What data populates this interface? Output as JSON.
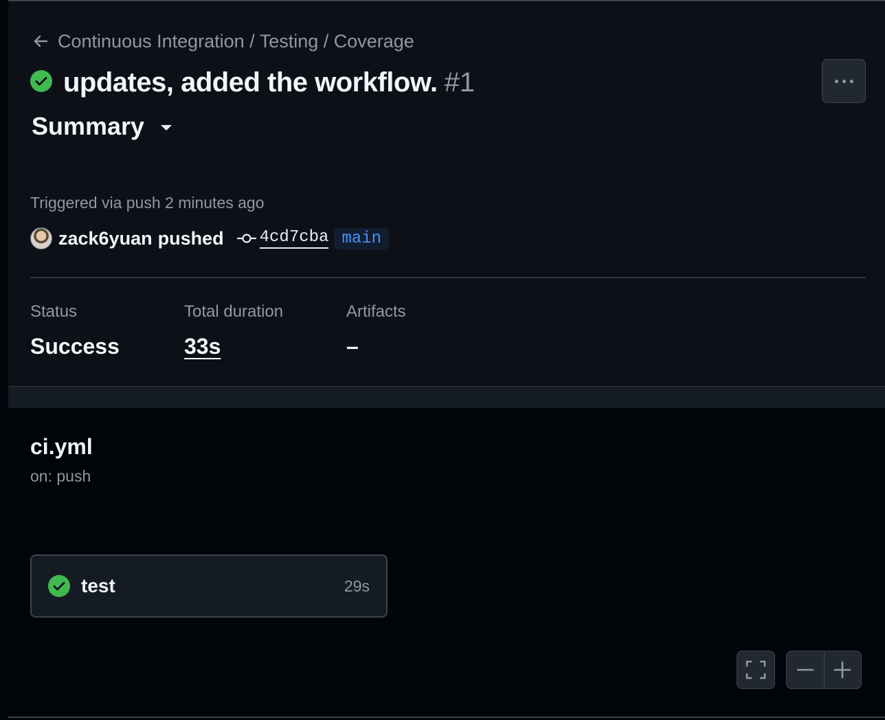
{
  "breadcrumb": {
    "back_icon": "arrow-left-icon",
    "text": "Continuous Integration / Testing / Coverage"
  },
  "run": {
    "status_icon": "check-circle-fill-icon",
    "title": "updates, added the workflow.",
    "number": "#1",
    "more_icon": "kebab-horizontal-icon"
  },
  "summary": {
    "label": "Summary",
    "caret_icon": "triangle-down-icon"
  },
  "trigger": {
    "text": "Triggered via push 2 minutes ago",
    "user": "zack6yuan",
    "action": "pushed",
    "commit_icon": "git-commit-icon",
    "commit_sha": "4cd7cba",
    "branch": "main"
  },
  "stats": {
    "status_label": "Status",
    "status_value": "Success",
    "duration_label": "Total duration",
    "duration_value": "33s",
    "artifacts_label": "Artifacts",
    "artifacts_value": "–"
  },
  "workflow": {
    "file": "ci.yml",
    "on": "on: push",
    "jobs": [
      {
        "name": "test",
        "duration": "29s",
        "status_icon": "check-circle-fill-icon"
      }
    ]
  },
  "graph_controls": {
    "fullscreen_icon": "screen-full-icon",
    "zoom_out_icon": "dash-icon",
    "zoom_in_icon": "plus-icon"
  },
  "colors": {
    "background": "#0d1117",
    "graph_background": "#010409",
    "success": "#3fb950",
    "branch_text": "#4493f8",
    "muted_text": "#9198a1"
  }
}
